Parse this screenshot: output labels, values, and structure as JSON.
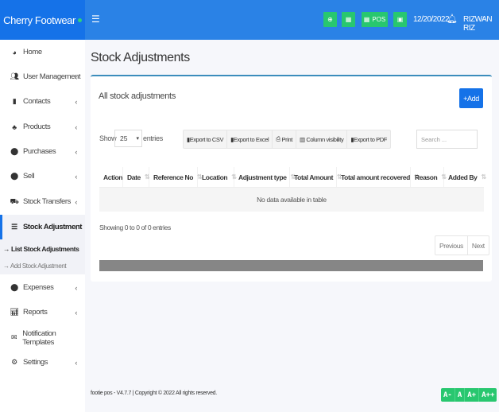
{
  "brand": {
    "name": "Cherry Footwear",
    "accent": "#1572e8",
    "status_dot_color": "#2fd17a"
  },
  "topbar": {
    "menu_icon": "hamburger-icon",
    "buttons": [
      {
        "icon": "plus-circle-icon",
        "label": ""
      },
      {
        "icon": "calculator-icon",
        "label": ""
      },
      {
        "icon": "grid-icon",
        "label": "POS"
      },
      {
        "icon": "money-icon",
        "label": ""
      }
    ],
    "date": "12/20/2022",
    "bell_icon": "bell-icon",
    "user": "RIZWAN RIZ",
    "button_color": "#28c76f"
  },
  "sidebar": {
    "items": [
      {
        "label": "Home",
        "icon": "dashboard-icon",
        "chevron": false
      },
      {
        "label": "User Management",
        "icon": "users-icon",
        "chevron": true
      },
      {
        "label": "Contacts",
        "icon": "address-book-icon",
        "chevron": true
      },
      {
        "label": "Products",
        "icon": "cubes-icon",
        "chevron": true
      },
      {
        "label": "Purchases",
        "icon": "arrow-circle-down-icon",
        "chevron": true
      },
      {
        "label": "Sell",
        "icon": "arrow-circle-up-icon",
        "chevron": true
      },
      {
        "label": "Stock Transfers",
        "icon": "truck-icon",
        "chevron": true
      },
      {
        "label": "Stock Adjustment",
        "icon": "database-icon",
        "chevron": true,
        "active": true
      },
      {
        "label": "Expenses",
        "icon": "minus-circle-icon",
        "chevron": true
      },
      {
        "label": "Reports",
        "icon": "chart-icon",
        "chevron": true
      },
      {
        "label": "Notification Templates",
        "icon": "envelope-icon",
        "chevron": false
      },
      {
        "label": "Settings",
        "icon": "cog-icon",
        "chevron": true
      }
    ],
    "subitems": [
      {
        "label": "→ List Stock Adjustments",
        "active": true
      },
      {
        "label": "→ Add Stock Adjustment",
        "active": false
      }
    ]
  },
  "page": {
    "title": "Stock Adjustments"
  },
  "card": {
    "title": "All stock adjustments",
    "add_label": "+Add",
    "show_label": "Show",
    "entries_value": "25",
    "entries_label": "entries",
    "export_buttons": [
      {
        "icon": "file-icon",
        "label": "Export to CSV"
      },
      {
        "icon": "file-excel-icon",
        "label": "Export to Excel"
      },
      {
        "icon": "print-icon",
        "label": "Print"
      },
      {
        "icon": "columns-icon",
        "label": "Column visibility"
      },
      {
        "icon": "file-pdf-icon",
        "label": "Export to PDF"
      }
    ],
    "search_placeholder": "Search ...",
    "columns": [
      "Action",
      "Date",
      "Reference No",
      "Location",
      "Adjustment type",
      "Total Amount",
      "Total amount recovered",
      "Reason",
      "Added By"
    ],
    "empty_message": "No data available in table",
    "info": "Showing 0 to 0 of 0 entries",
    "pager": {
      "previous": "Previous",
      "next": "Next"
    }
  },
  "footer": {
    "text": "footie pos - V4.7.7 | Copyright © 2022 All rights reserved.",
    "font_buttons": [
      "A-",
      "A",
      "A+",
      "A++"
    ]
  }
}
